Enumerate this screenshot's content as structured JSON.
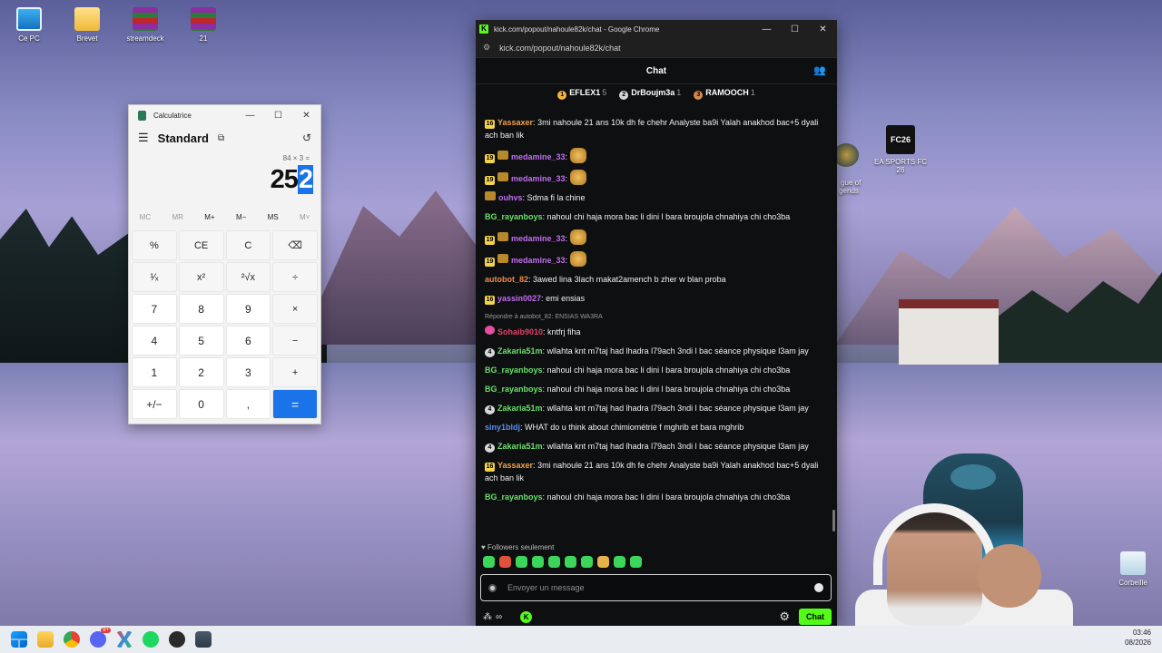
{
  "desktop": {
    "icons": [
      {
        "label": "Ce PC"
      },
      {
        "label": "Brevet"
      },
      {
        "label": "streamdeck"
      },
      {
        "label": "21"
      },
      {
        "label": "gue of\ngends"
      },
      {
        "label": "EA SPORTS FC 26"
      },
      {
        "label": "Corbeille"
      }
    ],
    "fc_logo": "FC26"
  },
  "calculator": {
    "window_title": "Calculatrice",
    "mode": "Standard",
    "expression": "84 × 3 =",
    "display_main": "25",
    "display_selected": "2",
    "memory": [
      "MC",
      "MR",
      "M+",
      "M−",
      "MS",
      "M˅"
    ],
    "keys": [
      "%",
      "CE",
      "C",
      "⌫",
      "¹⁄ₓ",
      "x²",
      "²√x",
      "÷",
      "7",
      "8",
      "9",
      "×",
      "4",
      "5",
      "6",
      "−",
      "1",
      "2",
      "3",
      "+",
      "+/−",
      "0",
      ",",
      "="
    ]
  },
  "chrome": {
    "window_title": "kick.com/popout/nahoule82k/chat - Google Chrome",
    "url": "kick.com/popout/nahoule82k/chat"
  },
  "chat": {
    "header": "Chat",
    "podium": [
      {
        "name": "EFLEX1",
        "count": "5",
        "color": "#f3b33d"
      },
      {
        "name": "DrBoujm3a",
        "count": "1",
        "color": "#d6d6d6"
      },
      {
        "name": "RAMOOCH",
        "count": "1",
        "color": "#d68a4a"
      }
    ],
    "messages": [
      {
        "badge": "16",
        "user": "Yassaxer",
        "color": "#f0a24a",
        "text": "3mi nahoule 21 ans 10k dh fe chehr Analyste ba9i Yalah anakhod bac+5 dyali ach ban lik"
      },
      {
        "badge": "19",
        "user": "medamine_33",
        "color": "#c06ef0",
        "text": ""
      },
      {
        "badge": "19",
        "user": "medamine_33",
        "color": "#c06ef0",
        "text": ""
      },
      {
        "badge": "",
        "user": "ouhvs",
        "color": "#c06ef0",
        "text": "Sdma fi la chine"
      },
      {
        "badge": "",
        "user": "BG_rayanboys",
        "color": "#6be06b",
        "text": "nahoul chi haja mora bac li dini l bara broujola chnahiya chi cho3ba"
      },
      {
        "badge": "19",
        "user": "medamine_33",
        "color": "#c06ef0",
        "text": ""
      },
      {
        "badge": "19",
        "user": "medamine_33",
        "color": "#c06ef0",
        "text": ""
      },
      {
        "badge": "",
        "user": "autobot_82",
        "color": "#f08a4a",
        "text": "3awed lina 3lach makat2amench b zher w blan proba"
      },
      {
        "badge": "16",
        "user": "yassin0027",
        "color": "#c06ef0",
        "text": "emi ensias"
      },
      {
        "badge": "",
        "user": "Sohaib9010",
        "color": "#e0436a",
        "text": "kntfrj fiha",
        "reply": "Répondre à autobot_82: ENSIAS WA3RA"
      },
      {
        "badge": "4",
        "user": "Zakaria51m",
        "color": "#6be06b",
        "text": "wllahta knt m7taj had lhadra l79ach 3ndi l bac séance physique l3am jay"
      },
      {
        "badge": "",
        "user": "BG_rayanboys",
        "color": "#6be06b",
        "text": "nahoul chi haja mora bac li dini l bara broujola chnahiya chi cho3ba"
      },
      {
        "badge": "",
        "user": "BG_rayanboys",
        "color": "#6be06b",
        "text": "nahoul chi haja mora bac li dini l bara broujola chnahiya chi cho3ba"
      },
      {
        "badge": "4",
        "user": "Zakaria51m",
        "color": "#6be06b",
        "text": "wllahta knt m7taj had lhadra l79ach 3ndi l bac séance physique l3am jay"
      },
      {
        "badge": "",
        "user": "siny1bldj",
        "color": "#5a8ef0",
        "text": "WHAT do u think about chimiométrie f mghrib et bara mghrib"
      },
      {
        "badge": "4",
        "user": "Zakaria51m",
        "color": "#6be06b",
        "text": "wllahta knt m7taj had lhadra l79ach 3ndi l bac séance physique l3am jay"
      },
      {
        "badge": "16",
        "user": "Yassaxer",
        "color": "#f0a24a",
        "text": "3mi nahoule 21 ans 10k dh fe chehr Analyste ba9i Yalah anakhod bac+5 dyali ach ban lik"
      },
      {
        "badge": "",
        "user": "BG_rayanboys",
        "color": "#6be06b",
        "text": "nahoul chi haja mora bac li dini l bara broujola chnahiya chi cho3ba"
      }
    ],
    "followers_only": "Followers seulement",
    "input_placeholder": "Envoyer un message",
    "chat_button": "Chat"
  },
  "taskbar": {
    "discord_badge": "9+",
    "time": "03:46",
    "date": "08/2026"
  }
}
